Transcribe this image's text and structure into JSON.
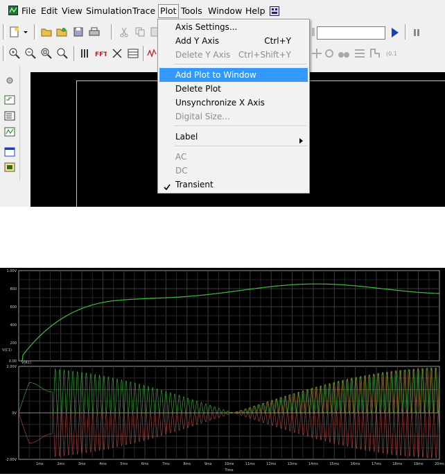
{
  "menubar": {
    "items": [
      {
        "label": "File"
      },
      {
        "label": "Edit"
      },
      {
        "label": "View"
      },
      {
        "label": "Simulation"
      },
      {
        "label": "Trace"
      },
      {
        "label": "Plot"
      },
      {
        "label": "Tools"
      },
      {
        "label": "Window"
      },
      {
        "label": "Help"
      }
    ],
    "open_menu": "Plot"
  },
  "plot_menu": {
    "items": [
      {
        "label": "Axis Settings...",
        "shortcut": "",
        "enabled": true
      },
      {
        "label": "Add Y Axis",
        "shortcut": "Ctrl+Y",
        "enabled": true
      },
      {
        "label": "Delete Y Axis",
        "shortcut": "Ctrl+Shift+Y",
        "enabled": false
      },
      {
        "label": "Add Plot to Window",
        "shortcut": "",
        "enabled": true,
        "highlighted": true
      },
      {
        "label": "Delete Plot",
        "shortcut": "",
        "enabled": true
      },
      {
        "label": "Unsynchronize X Axis",
        "shortcut": "",
        "enabled": true
      },
      {
        "label": "Digital Size...",
        "shortcut": "",
        "enabled": false
      },
      {
        "label": "Label",
        "shortcut": "",
        "enabled": true,
        "submenu": true
      },
      {
        "label": "AC",
        "shortcut": "",
        "enabled": false
      },
      {
        "label": "DC",
        "shortcut": "",
        "enabled": false
      },
      {
        "label": "Transient",
        "shortcut": "",
        "enabled": true,
        "checked": true
      }
    ]
  },
  "icons": {
    "menu_highlight": "#3399ff",
    "plot_background": "#000000",
    "trace_green": "#3fbf3f",
    "trace_red": "#c0504d",
    "trace_orange": "#d08a2a"
  },
  "waveform": {
    "top_plot": {
      "y_ticks": [
        "1.00V",
        "800",
        "600",
        "400",
        "200",
        "0.00"
      ],
      "legend": "V(C1)"
    },
    "bottom_plot": {
      "y_ticks": [
        "2.00V",
        "0V",
        "-2.00V"
      ],
      "legend": "V(R1)"
    },
    "x_ticks": [
      "1ms",
      "2ms",
      "3ms",
      "4ms",
      "5ms",
      "6ms",
      "7ms",
      "8ms",
      "9ms",
      "10ms",
      "11ms",
      "12ms",
      "13ms",
      "14ms",
      "15ms",
      "16ms",
      "17ms",
      "18ms",
      "19ms",
      "20ms"
    ],
    "x_label": "Time"
  }
}
